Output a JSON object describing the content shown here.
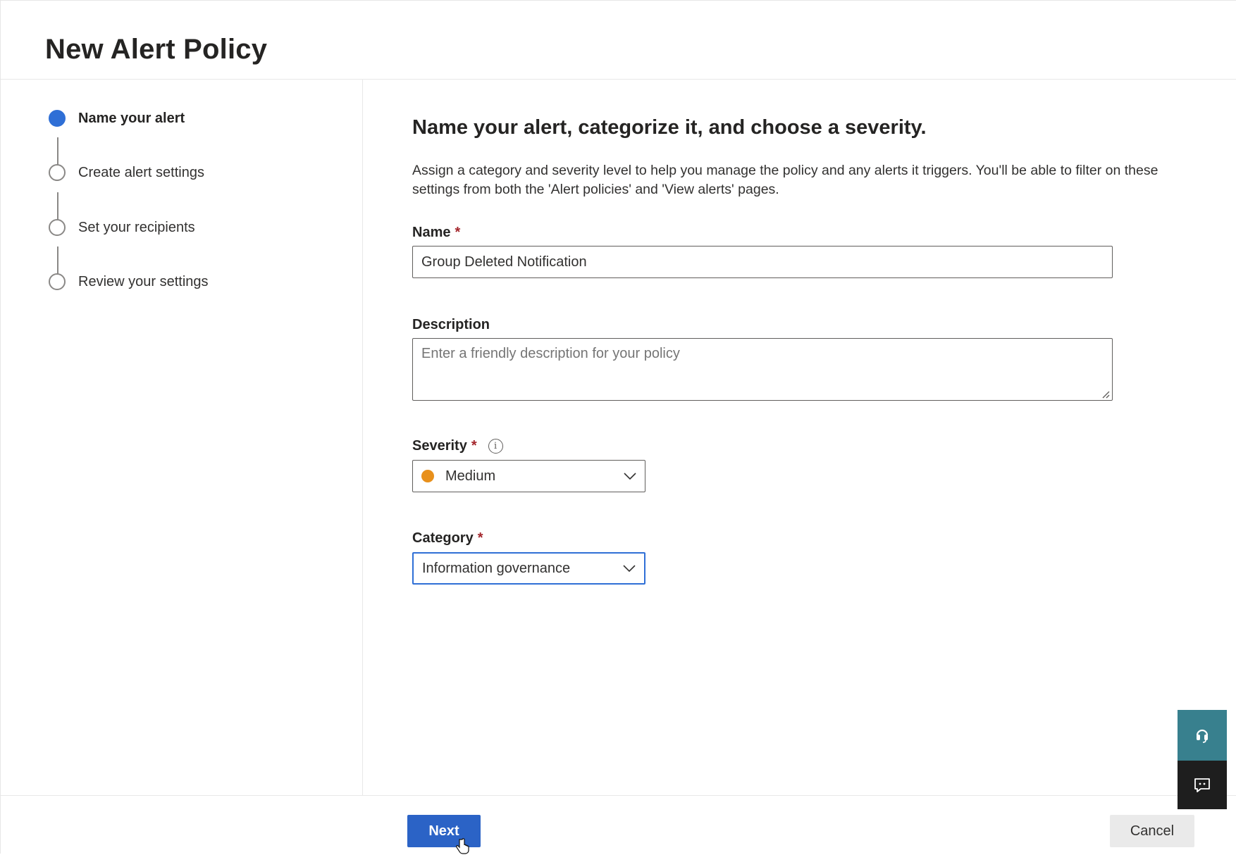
{
  "page": {
    "title": "New Alert Policy"
  },
  "steps": [
    {
      "label": "Name your alert",
      "active": true
    },
    {
      "label": "Create alert settings",
      "active": false
    },
    {
      "label": "Set your recipients",
      "active": false
    },
    {
      "label": "Review your settings",
      "active": false
    }
  ],
  "main": {
    "heading": "Name your alert, categorize it, and choose a severity.",
    "description": "Assign a category and severity level to help you manage the policy and any alerts it triggers. You'll be able to filter on these settings from both the 'Alert policies' and 'View alerts' pages."
  },
  "form": {
    "name": {
      "label": "Name",
      "required_mark": "*",
      "value": "Group Deleted Notification"
    },
    "description": {
      "label": "Description",
      "placeholder": "Enter a friendly description for your policy"
    },
    "severity": {
      "label": "Severity",
      "required_mark": "*",
      "info_glyph": "i",
      "value": "Medium",
      "dot_color": "#e8901b"
    },
    "category": {
      "label": "Category",
      "required_mark": "*",
      "value": "Information governance"
    }
  },
  "footer": {
    "next_label": "Next",
    "cancel_label": "Cancel"
  },
  "colors": {
    "accent": "#2b63c6",
    "step_active": "#2f6fd6",
    "help_bg": "#38808e",
    "feedback_bg": "#1e1e1e"
  }
}
